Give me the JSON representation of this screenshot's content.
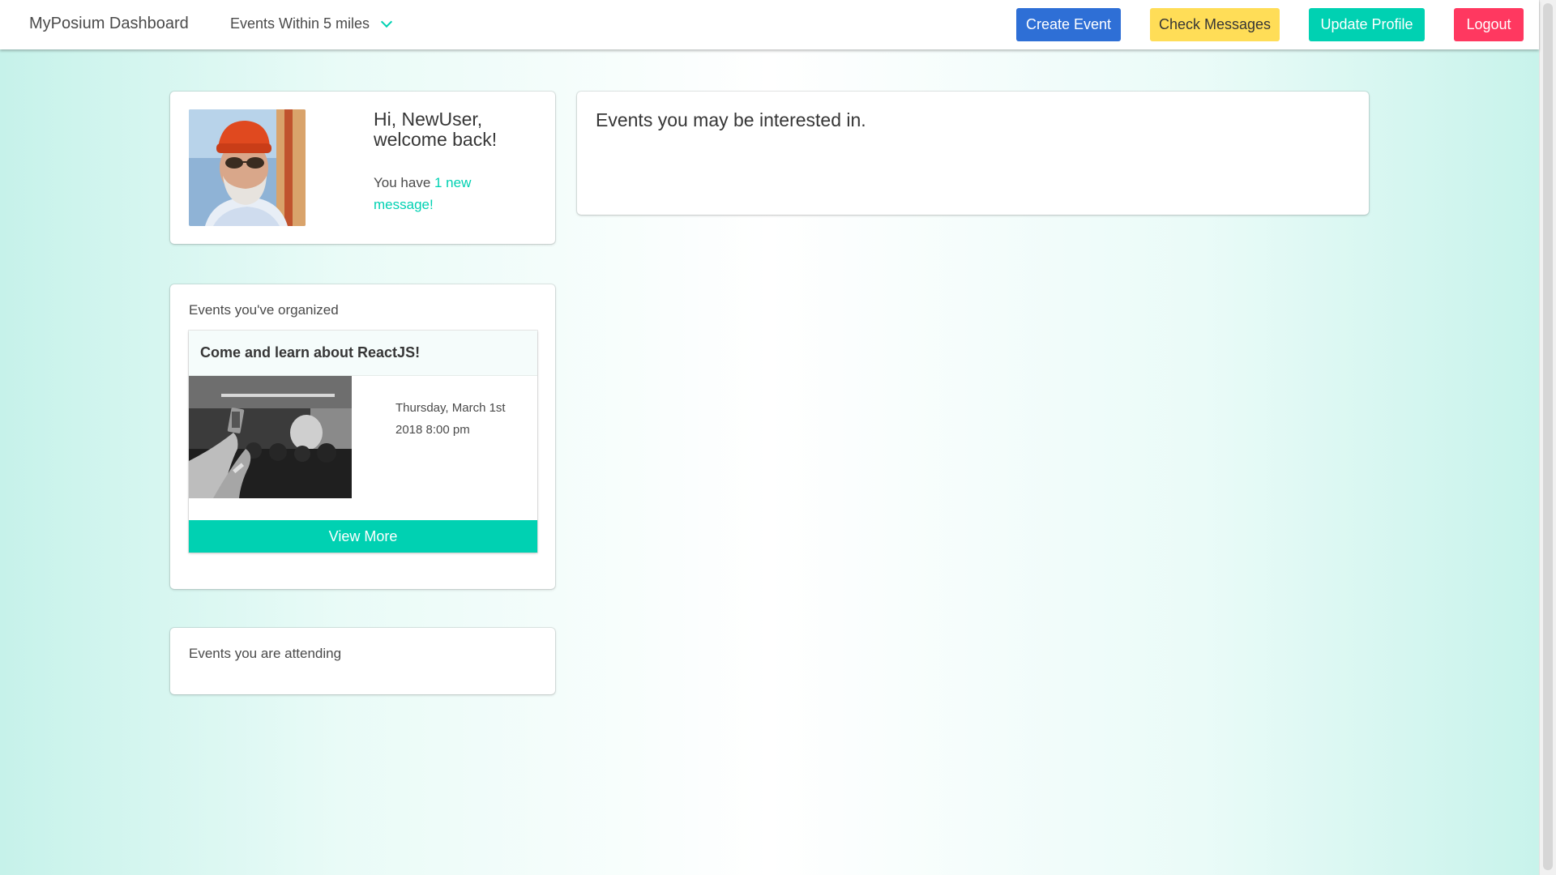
{
  "navbar": {
    "brand": "MyPosium Dashboard",
    "filter_label": "Events Within 5 miles",
    "buttons": {
      "create_event": "Create Event",
      "check_messages": "Check Messages",
      "update_profile": "Update Profile",
      "logout": "Logout"
    }
  },
  "welcome": {
    "greeting": "Hi, NewUser, welcome back!",
    "message_prefix": "You have ",
    "message_link": "1 new message!"
  },
  "interests": {
    "title": "Events you may be interested in."
  },
  "organized": {
    "title": "Events you've organized",
    "events": [
      {
        "title": "Come and learn about ReactJS!",
        "date": "Thursday, March 1st 2018 8:00 pm",
        "button": "View More"
      }
    ]
  },
  "attending": {
    "title": "Events you are attending"
  },
  "colors": {
    "primary": "#00d1b2",
    "link": "#2e6fd6",
    "warning": "#ffdd57",
    "danger": "#ff3860"
  }
}
